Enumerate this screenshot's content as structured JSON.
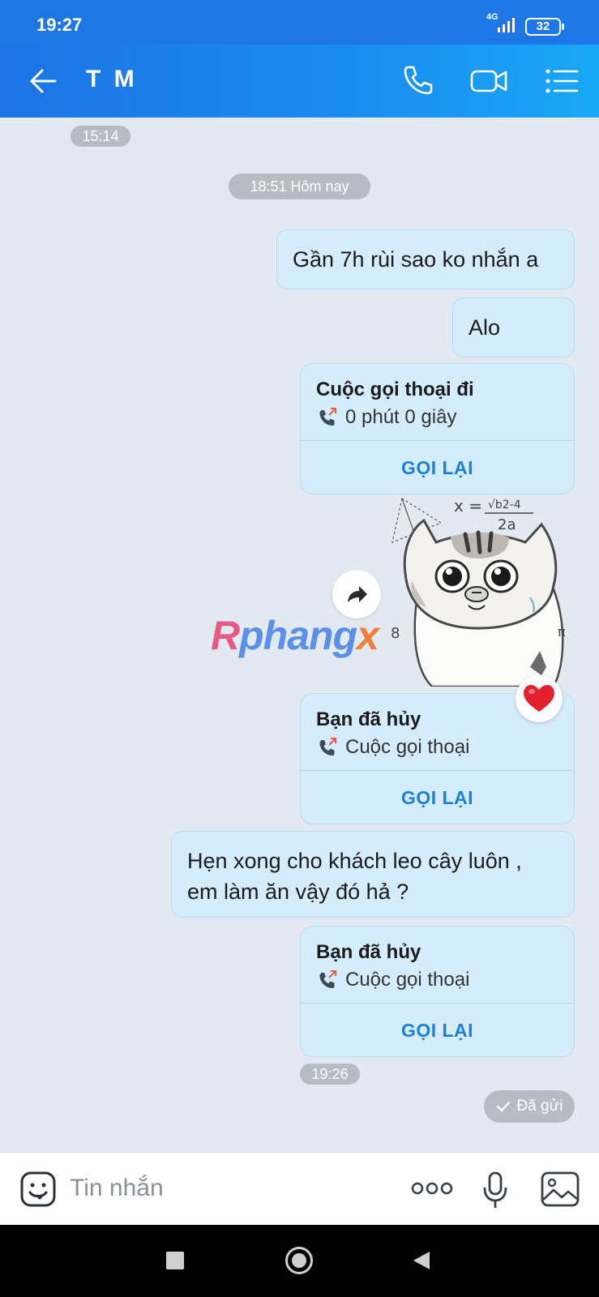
{
  "status_bar": {
    "time": "19:27",
    "network": "4G",
    "battery": "32"
  },
  "header": {
    "title": "T M"
  },
  "chat": {
    "time_pill_1": "15:14",
    "time_pill_2": "18:51 Hôm nay",
    "msg_1": "Gần 7h rùi sao ko nhắn a",
    "msg_2": "Alo",
    "call_1": {
      "title": "Cuộc gọi thoại đi",
      "subtitle": "0 phút 0 giây",
      "button": "GỌI LẠI"
    },
    "watermark": "Rphangx",
    "call_2": {
      "title": "Bạn đã hủy",
      "subtitle": "Cuộc gọi thoại",
      "button": "GỌI LẠI"
    },
    "msg_3_line_1": "Hẹn xong cho khách leo cây luôn ,",
    "msg_3_line_2": "em làm ăn vậy đó hả ?",
    "call_3": {
      "title": "Bạn đã hủy",
      "subtitle": "Cuộc gọi thoại",
      "button": "GỌI LẠI"
    },
    "time_pill_3": "19:26",
    "status": "Đã gửi"
  },
  "input": {
    "placeholder": "Tin nhắn"
  },
  "colors": {
    "accent": "#1a8df0",
    "bubble": "#d4ecfc",
    "link": "#1980d6"
  }
}
